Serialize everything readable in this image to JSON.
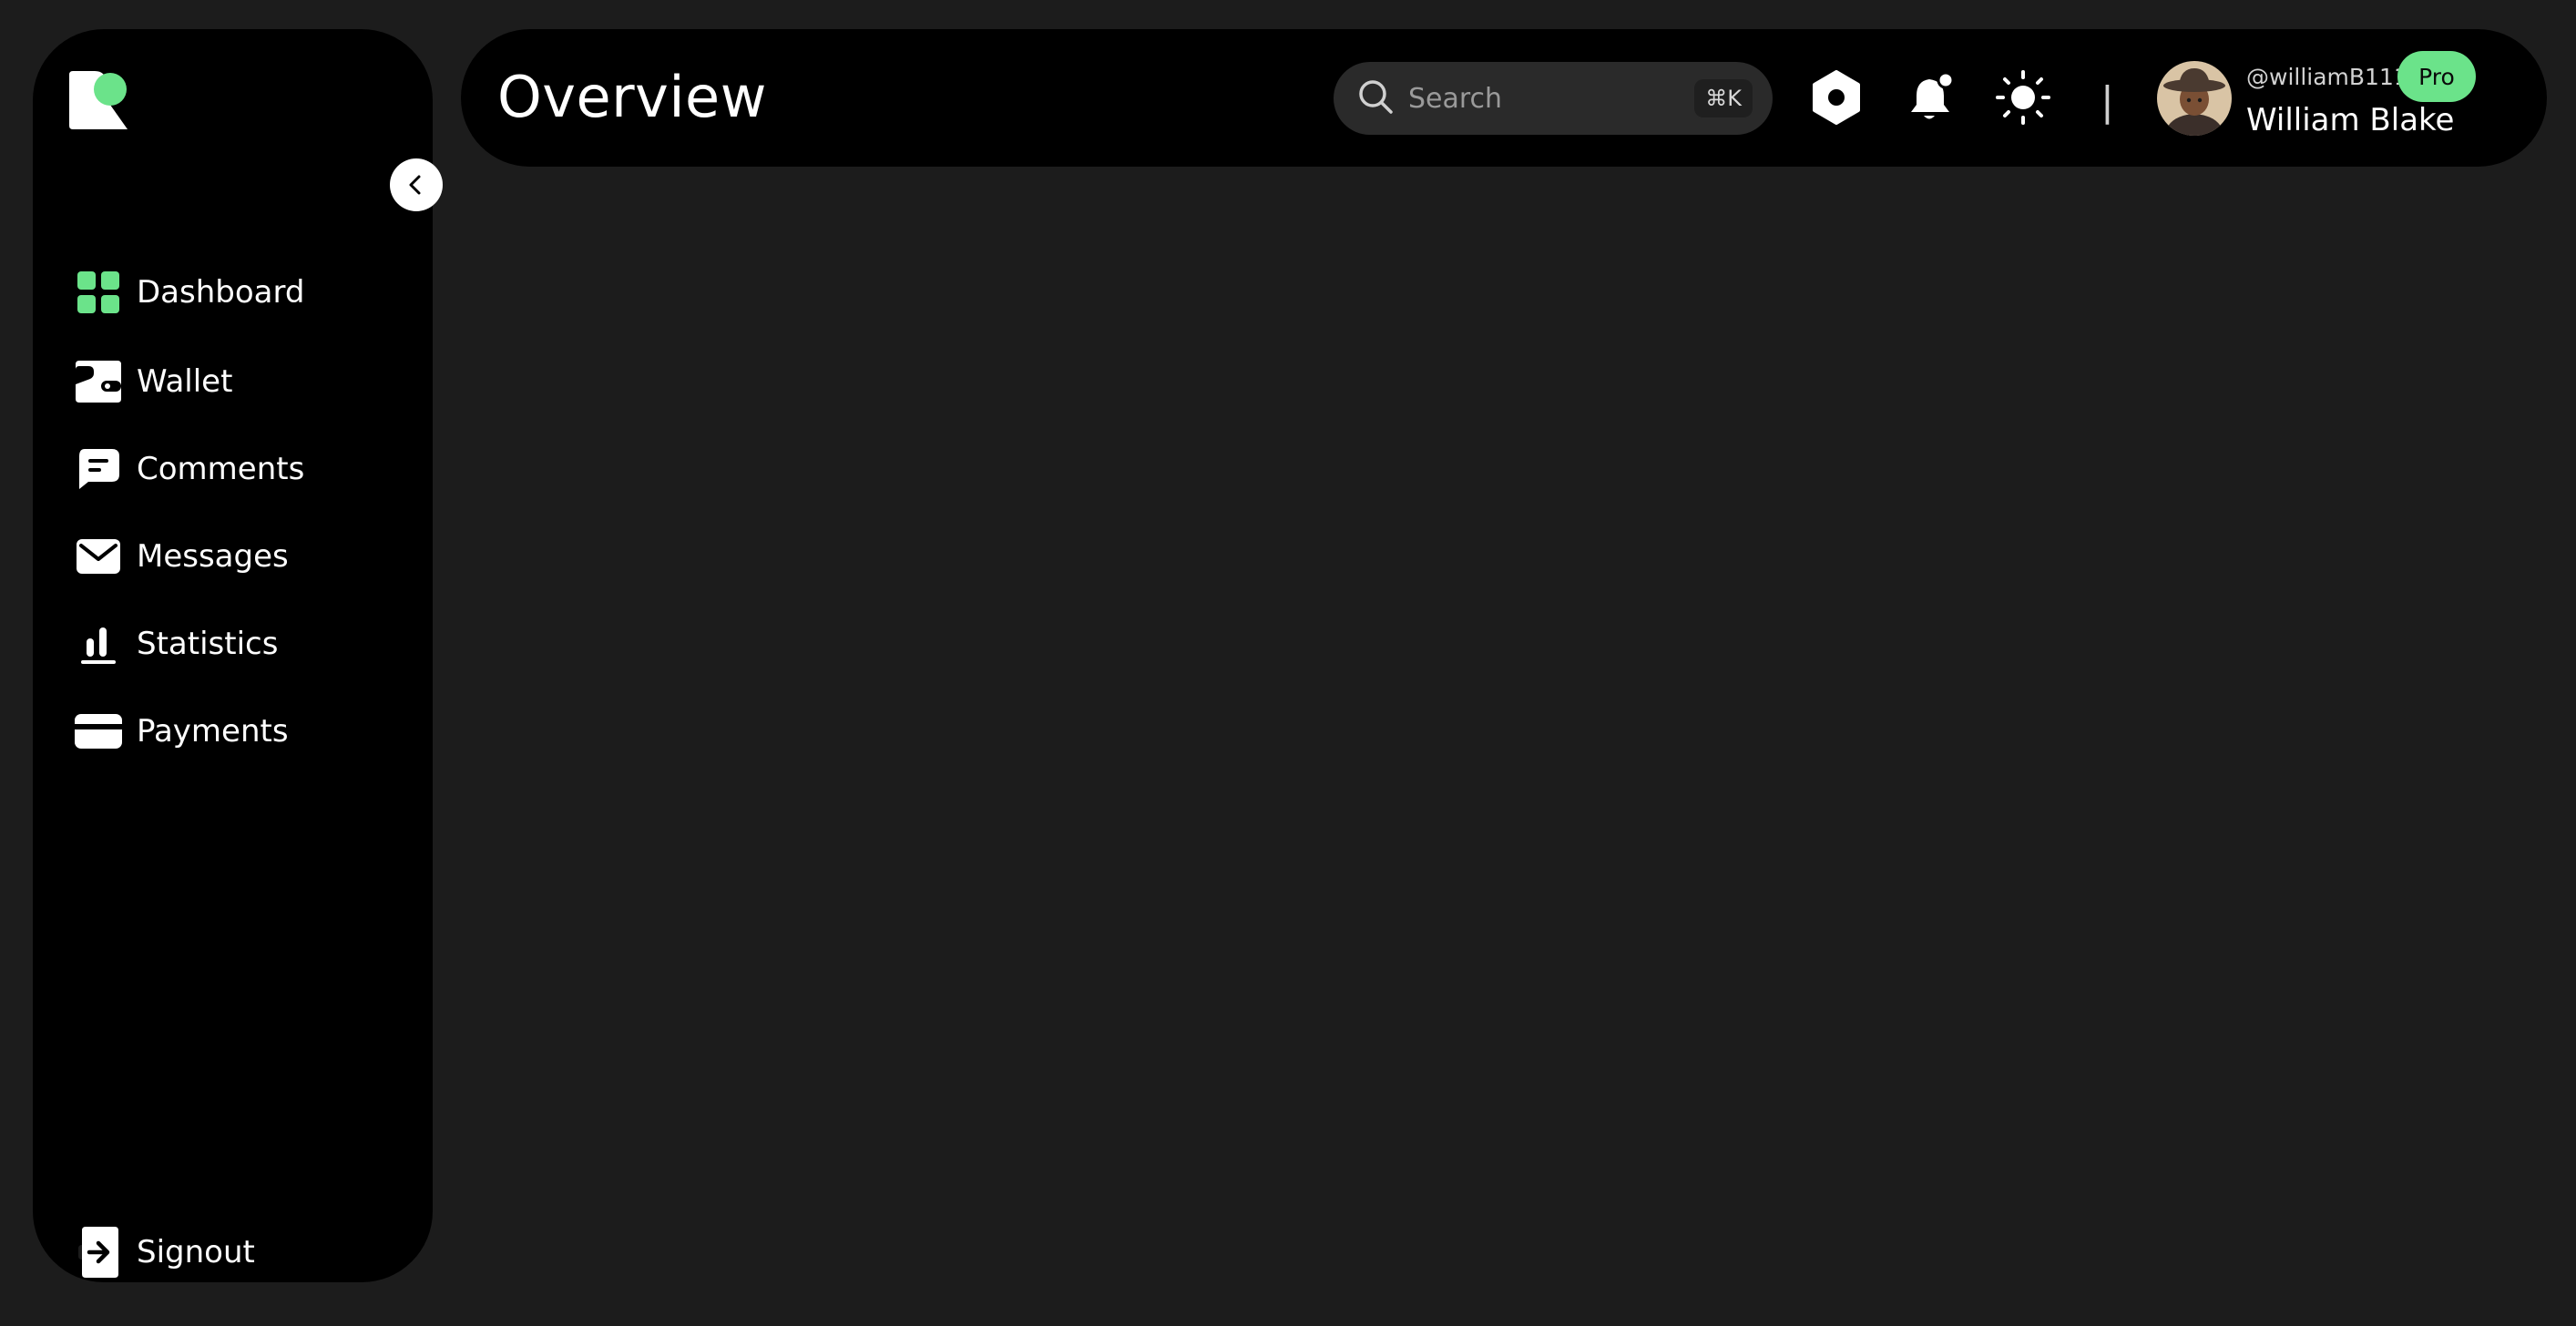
{
  "header": {
    "title": "Overview",
    "search_placeholder": "Search",
    "search_shortcut": "⌘K",
    "divider": "|"
  },
  "user": {
    "handle": "@williamB1111",
    "name": "William Blake",
    "badge": "Pro"
  },
  "sidebar": {
    "items": [
      {
        "label": "Dashboard",
        "icon": "dashboard-grid-icon"
      },
      {
        "label": "Wallet",
        "icon": "wallet-icon"
      },
      {
        "label": "Comments",
        "icon": "comment-icon"
      },
      {
        "label": "Messages",
        "icon": "envelope-icon"
      },
      {
        "label": "Statistics",
        "icon": "bar-chart-icon"
      },
      {
        "label": "Payments",
        "icon": "credit-card-icon"
      }
    ],
    "signout_label": "Signout"
  },
  "colors": {
    "accent": "#6be38a",
    "panel": "#000000",
    "background": "#1c1c1c"
  }
}
